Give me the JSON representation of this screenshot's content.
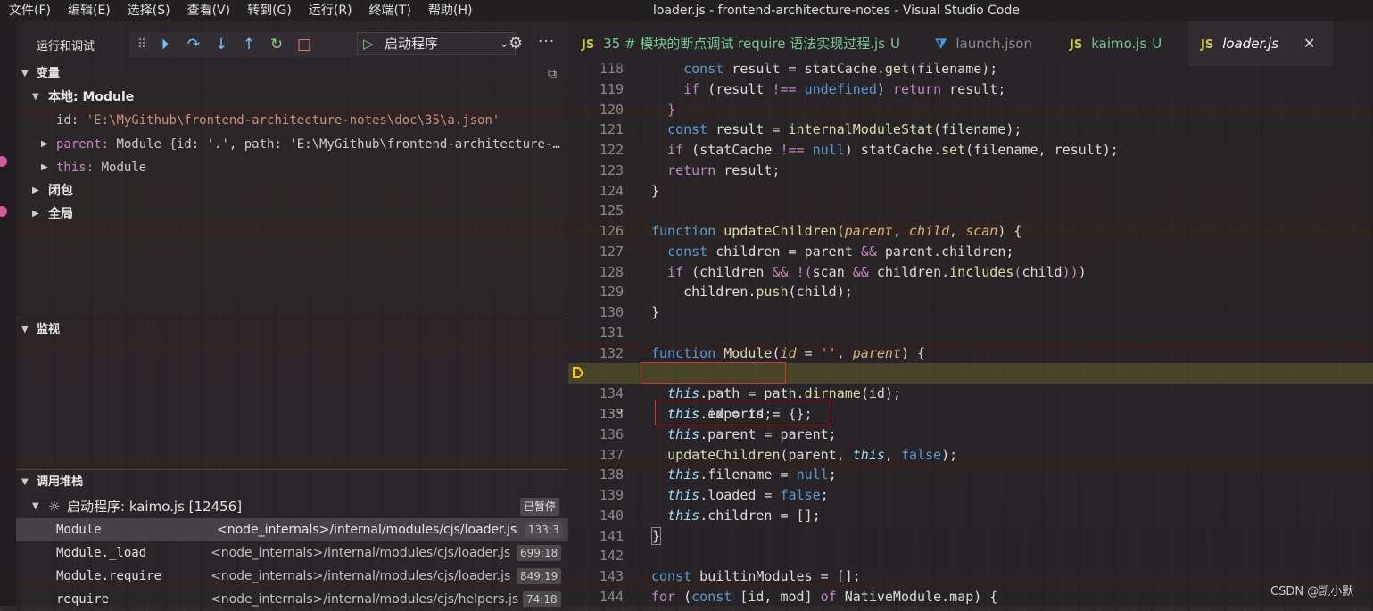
{
  "menu": [
    "文件(F)",
    "编辑(E)",
    "选择(S)",
    "查看(V)",
    "转到(G)",
    "运行(R)",
    "终端(T)",
    "帮助(H)"
  ],
  "window_title": "loader.js - frontend-architecture-notes - Visual Studio Code",
  "sidebar": {
    "title": "运行和调试",
    "launch_config": "启动程序",
    "toolbar_icons": [
      "continue-icon",
      "step-over-icon",
      "step-into-icon",
      "step-out-icon",
      "restart-icon",
      "stop-icon"
    ],
    "variables": {
      "header": "变量",
      "local_scope": "本地: Module",
      "items": [
        {
          "name": "id:",
          "value": "'E:\\MyGithub\\frontend-architecture-notes\\doc\\35\\a.json'"
        },
        {
          "name": "parent:",
          "value": "Module {id: '.', path: 'E:\\MyGithub\\frontend-architecture-…"
        },
        {
          "name": "this:",
          "value": "Module"
        }
      ],
      "scopes": [
        "闭包",
        "全局"
      ]
    },
    "watch": {
      "header": "监视"
    },
    "callstack": {
      "header": "调用堆栈",
      "thread": "启动程序: kaimo.js [12456]",
      "status": "已暂停",
      "frames": [
        {
          "name": "Module",
          "path": "<node_internals>/internal/modules/cjs/loader.js",
          "pos": "133:3"
        },
        {
          "name": "Module._load",
          "path": "<node_internals>/internal/modules/cjs/loader.js",
          "pos": "699:18"
        },
        {
          "name": "Module.require",
          "path": "<node_internals>/internal/modules/cjs/loader.js",
          "pos": "849:19"
        },
        {
          "name": "require",
          "path": "<node_internals>/internal/modules/cjs/helpers.js",
          "pos": "74:18"
        }
      ]
    }
  },
  "editor": {
    "tabs": [
      {
        "prefix": "JS",
        "label": "35 # 模块的断点调试 require 语法实现过程.js",
        "suffix": "U",
        "color": "#73c991"
      },
      {
        "prefix": "",
        "label": "launch.json",
        "suffix": "",
        "color": "#8c8c8c"
      },
      {
        "prefix": "JS",
        "label": "kaimo.js",
        "suffix": "U",
        "color": "#73c991"
      },
      {
        "prefix": "JS",
        "label": "loader.js",
        "suffix": "",
        "color": "#ffffff"
      }
    ],
    "current_line": 133,
    "line_numbers": [
      "118",
      "119",
      "120",
      "121",
      "122",
      "123",
      "124",
      "125",
      "126",
      "127",
      "128",
      "129",
      "130",
      "131",
      "132",
      "133",
      "134",
      "135",
      "136",
      "137",
      "138",
      "139",
      "140",
      "141",
      "142",
      "143",
      "144"
    ]
  },
  "watermark": "CSDN @凯小默",
  "colors": {
    "accent": "#75beff",
    "breakpoint": "#ffcc00",
    "highlight_box": "#e03030"
  }
}
